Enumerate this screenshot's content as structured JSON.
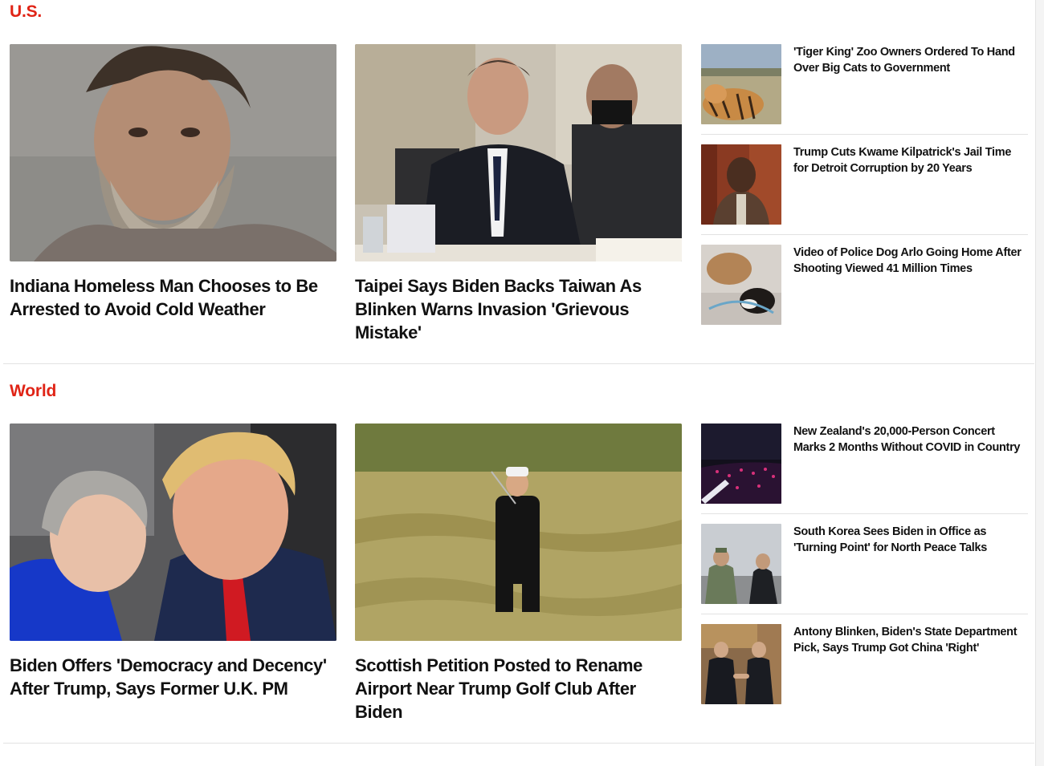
{
  "sections": [
    {
      "title": "U.S.",
      "features": [
        {
          "headline": "Indiana Homeless Man Chooses to Be Arrested to Avoid Cold Weather",
          "image": "mugshot-photo"
        },
        {
          "headline": "Taipei Says Biden Backs Taiwan As Blinken Warns Invasion 'Grievous Mistake'",
          "image": "hearing-photo"
        }
      ],
      "side_items": [
        {
          "headline": "'Tiger King' Zoo Owners Ordered To Hand Over Big Cats to Government",
          "image": "tiger-photo"
        },
        {
          "headline": "Trump Cuts Kwame Kilpatrick's Jail Time for Detroit Corruption by 20 Years",
          "image": "courtroom-photo"
        },
        {
          "headline": "Video of Police Dog Arlo Going Home After Shooting Viewed 41 Million Times",
          "image": "dog-photo"
        }
      ]
    },
    {
      "title": "World",
      "features": [
        {
          "headline": "Biden Offers 'Democracy and Decency' After Trump, Says Former U.K. PM",
          "image": "leaders-photo"
        },
        {
          "headline": "Scottish Petition Posted to Rename Airport Near Trump Golf Club After Biden",
          "image": "golf-photo"
        }
      ],
      "side_items": [
        {
          "headline": "New Zealand's 20,000-Person Concert Marks 2 Months Without COVID in Country",
          "image": "concert-photo"
        },
        {
          "headline": "South Korea Sees Biden in Office as 'Turning Point' for North Peace Talks",
          "image": "soldiers-photo"
        },
        {
          "headline": "Antony Blinken, Biden's State Department Pick, Says Trump Got China 'Right'",
          "image": "handshake-photo"
        }
      ]
    }
  ],
  "colors": {
    "section_title": "#e02416",
    "headline": "#111111",
    "divider": "#e2e2e2"
  }
}
